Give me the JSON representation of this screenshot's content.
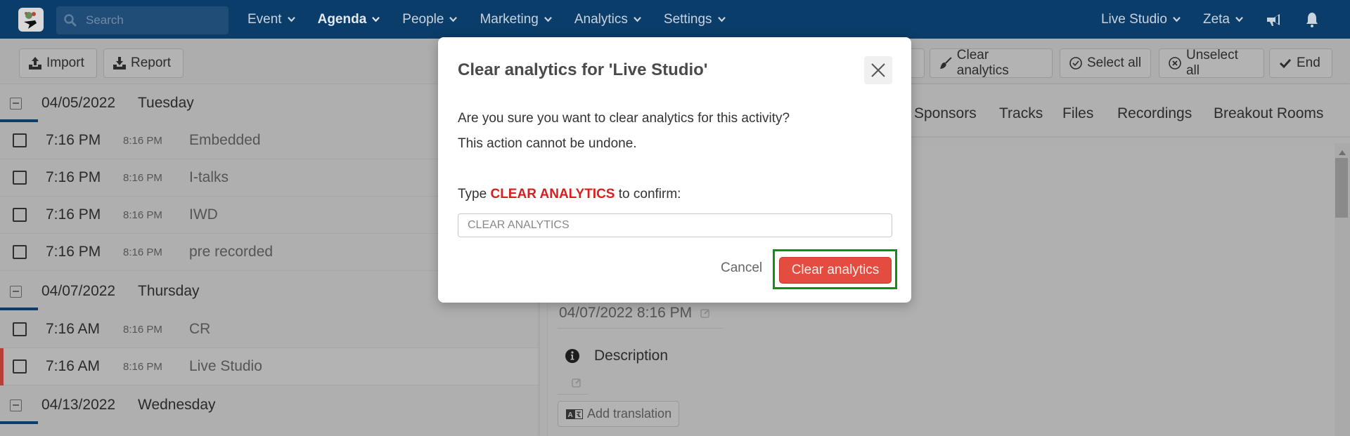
{
  "navbar": {
    "search_placeholder": "Search",
    "menu": [
      {
        "label": "Event",
        "icon": "chevron-down-icon"
      },
      {
        "label": "Agenda",
        "icon": "chevron-down-icon",
        "active": true
      },
      {
        "label": "People",
        "icon": "chevron-down-icon"
      },
      {
        "label": "Marketing",
        "icon": "chevron-down-icon"
      },
      {
        "label": "Analytics",
        "icon": "chevron-down-icon"
      },
      {
        "label": "Settings",
        "icon": "chevron-down-icon"
      }
    ],
    "right": {
      "event_selector": "Live Studio",
      "user": "Zeta",
      "icons": [
        "megaphone-icon",
        "bell-icon"
      ]
    },
    "colors": {
      "background": "#0a3d69"
    }
  },
  "toolbar": {
    "left_buttons": [
      {
        "label": "Import",
        "icon": "upload-icon"
      },
      {
        "label": "Report",
        "icon": "download-icon"
      }
    ],
    "right_buttons": [
      {
        "label": "Clear analytics",
        "icon": "brush-icon"
      },
      {
        "label": "Select all",
        "icon": "check-circle-icon"
      },
      {
        "label": "Unselect all",
        "icon": "x-circle-icon"
      },
      {
        "label": "End",
        "icon": "check-icon"
      }
    ]
  },
  "agenda": {
    "days": [
      {
        "date": "04/05/2022",
        "weekday": "Tuesday",
        "sessions": [
          {
            "start": "7:16 PM",
            "end": "8:16 PM",
            "title": "Embedded"
          },
          {
            "start": "7:16 PM",
            "end": "8:16 PM",
            "title": "I-talks"
          },
          {
            "start": "7:16 PM",
            "end": "8:16 PM",
            "title": "IWD"
          },
          {
            "start": "7:16 PM",
            "end": "8:16 PM",
            "title": "pre recorded"
          }
        ]
      },
      {
        "date": "04/07/2022",
        "weekday": "Thursday",
        "sessions": [
          {
            "start": "7:16 AM",
            "end": "8:16 PM",
            "title": "CR"
          },
          {
            "start": "7:16 AM",
            "end": "8:16 PM",
            "title": "Live Studio",
            "selected": true
          }
        ]
      },
      {
        "date": "04/13/2022",
        "weekday": "Wednesday",
        "sessions": []
      }
    ]
  },
  "detail": {
    "tabs": [
      "Sponsors",
      "Tracks",
      "Files",
      "Recordings",
      "Breakout Rooms"
    ],
    "end_datetime": "04/07/2022 8:16 PM",
    "description_label": "Description",
    "add_translation_label": "Add translation"
  },
  "modal": {
    "title": "Clear analytics for 'Live Studio'",
    "message_line1": "Are you sure you want to clear analytics for this activity?",
    "message_line2": "This action cannot be undone.",
    "confirm_prefix": "Type",
    "confirm_keyword": "CLEAR ANALYTICS",
    "confirm_suffix": "to confirm:",
    "input_value": "",
    "input_placeholder": "CLEAR ANALYTICS",
    "cancel_label": "Cancel",
    "confirm_button_label": "Clear analytics",
    "colors": {
      "danger": "#e34c3e",
      "keyword": "#d81e1e",
      "highlight": "#109010"
    }
  }
}
